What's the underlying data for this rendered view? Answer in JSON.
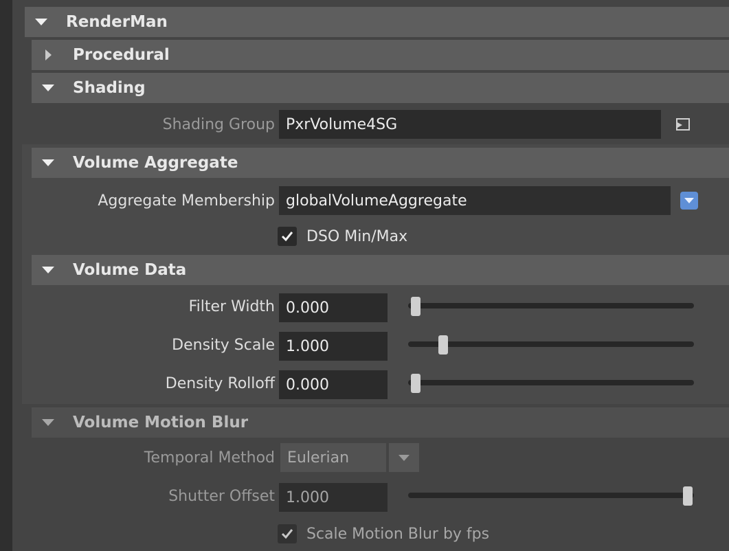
{
  "sections": {
    "renderman": {
      "title": "RenderMan",
      "expanded": true
    },
    "procedural": {
      "title": "Procedural",
      "expanded": false
    },
    "shading": {
      "title": "Shading",
      "expanded": true
    },
    "volume_aggregate": {
      "title": "Volume Aggregate",
      "expanded": true
    },
    "volume_data": {
      "title": "Volume Data",
      "expanded": true
    },
    "volume_motion_blur": {
      "title": "Volume Motion Blur",
      "expanded": true
    }
  },
  "shading": {
    "shading_group_label": "Shading Group",
    "shading_group_value": "PxrVolume4SG",
    "connect_icon": "input-connect-icon"
  },
  "volume_aggregate": {
    "membership_label": "Aggregate Membership",
    "membership_value": "globalVolumeAggregate",
    "dso_label": "DSO Min/Max",
    "dso_checked": true
  },
  "volume_data": {
    "filter_width_label": "Filter Width",
    "filter_width_value": "0.000",
    "filter_width_slider": 0.0,
    "density_scale_label": "Density Scale",
    "density_scale_value": "1.000",
    "density_scale_slider": 0.1,
    "density_rolloff_label": "Density Rolloff",
    "density_rolloff_value": "0.000",
    "density_rolloff_slider": 0.0
  },
  "volume_motion_blur": {
    "temporal_method_label": "Temporal Method",
    "temporal_method_value": "Eulerian",
    "shutter_offset_label": "Shutter Offset",
    "shutter_offset_value": "1.000",
    "shutter_offset_slider": 1.0,
    "scale_fps_label": "Scale Motion Blur by fps",
    "scale_fps_checked": true
  },
  "colors": {
    "accent_dropdown": "#5f8fd6",
    "header_bg": "#5d5d5d",
    "field_bg": "#2b2b2b"
  }
}
